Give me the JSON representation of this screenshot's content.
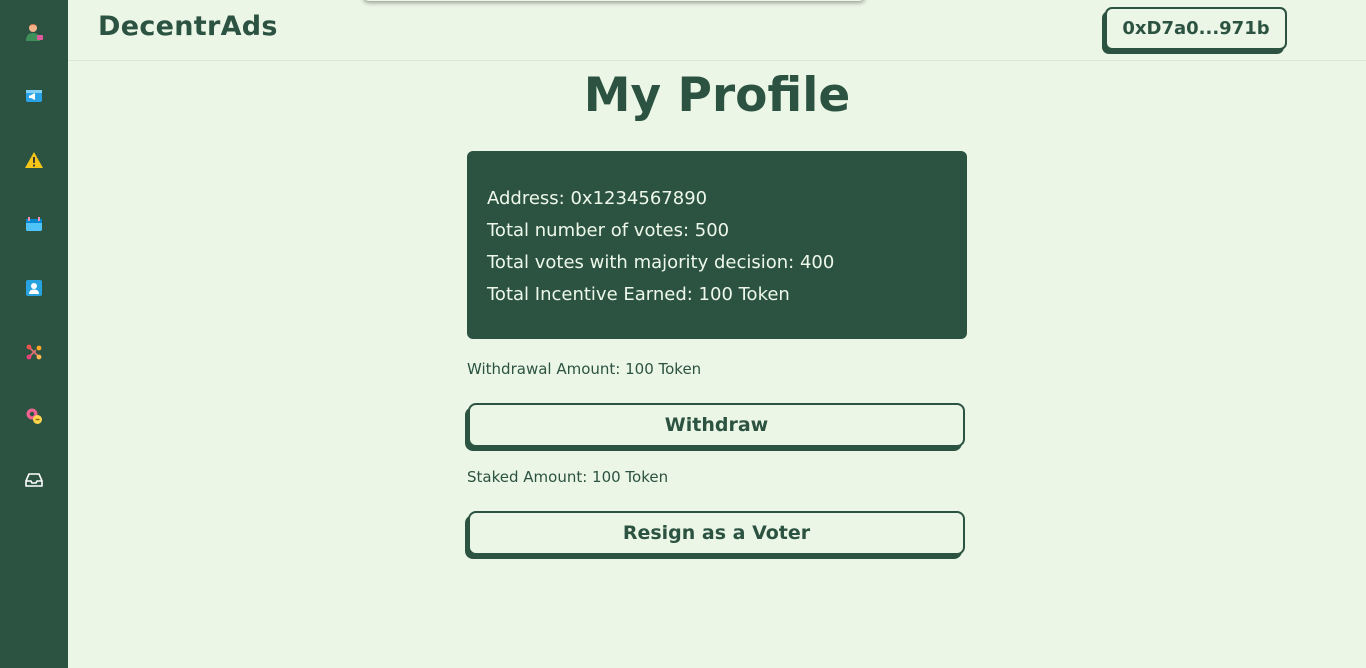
{
  "app": {
    "brand": "DecentrAds"
  },
  "sidebar": {
    "items": [
      {
        "name": "profile-avatar-icon"
      },
      {
        "name": "ads-icon"
      },
      {
        "name": "warning-icon"
      },
      {
        "name": "campaign-icon"
      },
      {
        "name": "user-icon"
      },
      {
        "name": "network-icon"
      },
      {
        "name": "settings-badge-icon"
      },
      {
        "name": "inbox-icon"
      }
    ]
  },
  "header": {
    "wallet_label": "0xD7a0...971b"
  },
  "main": {
    "title": "My Profile",
    "card": {
      "address": "Address: 0x1234567890",
      "total_votes": "Total number of votes: 500",
      "majority_votes": "Total votes with majority decision: 400",
      "incentive": "Total Incentive Earned: 100 Token"
    },
    "withdrawal_label": "Withdrawal Amount: 100 Token",
    "withdraw_button": "Withdraw",
    "staked_label": "Staked Amount: 100 Token",
    "resign_button": "Resign as a Voter"
  },
  "colors": {
    "primary": "#2c5341",
    "background": "#ebf6e6",
    "card_text": "#eef8ea"
  }
}
